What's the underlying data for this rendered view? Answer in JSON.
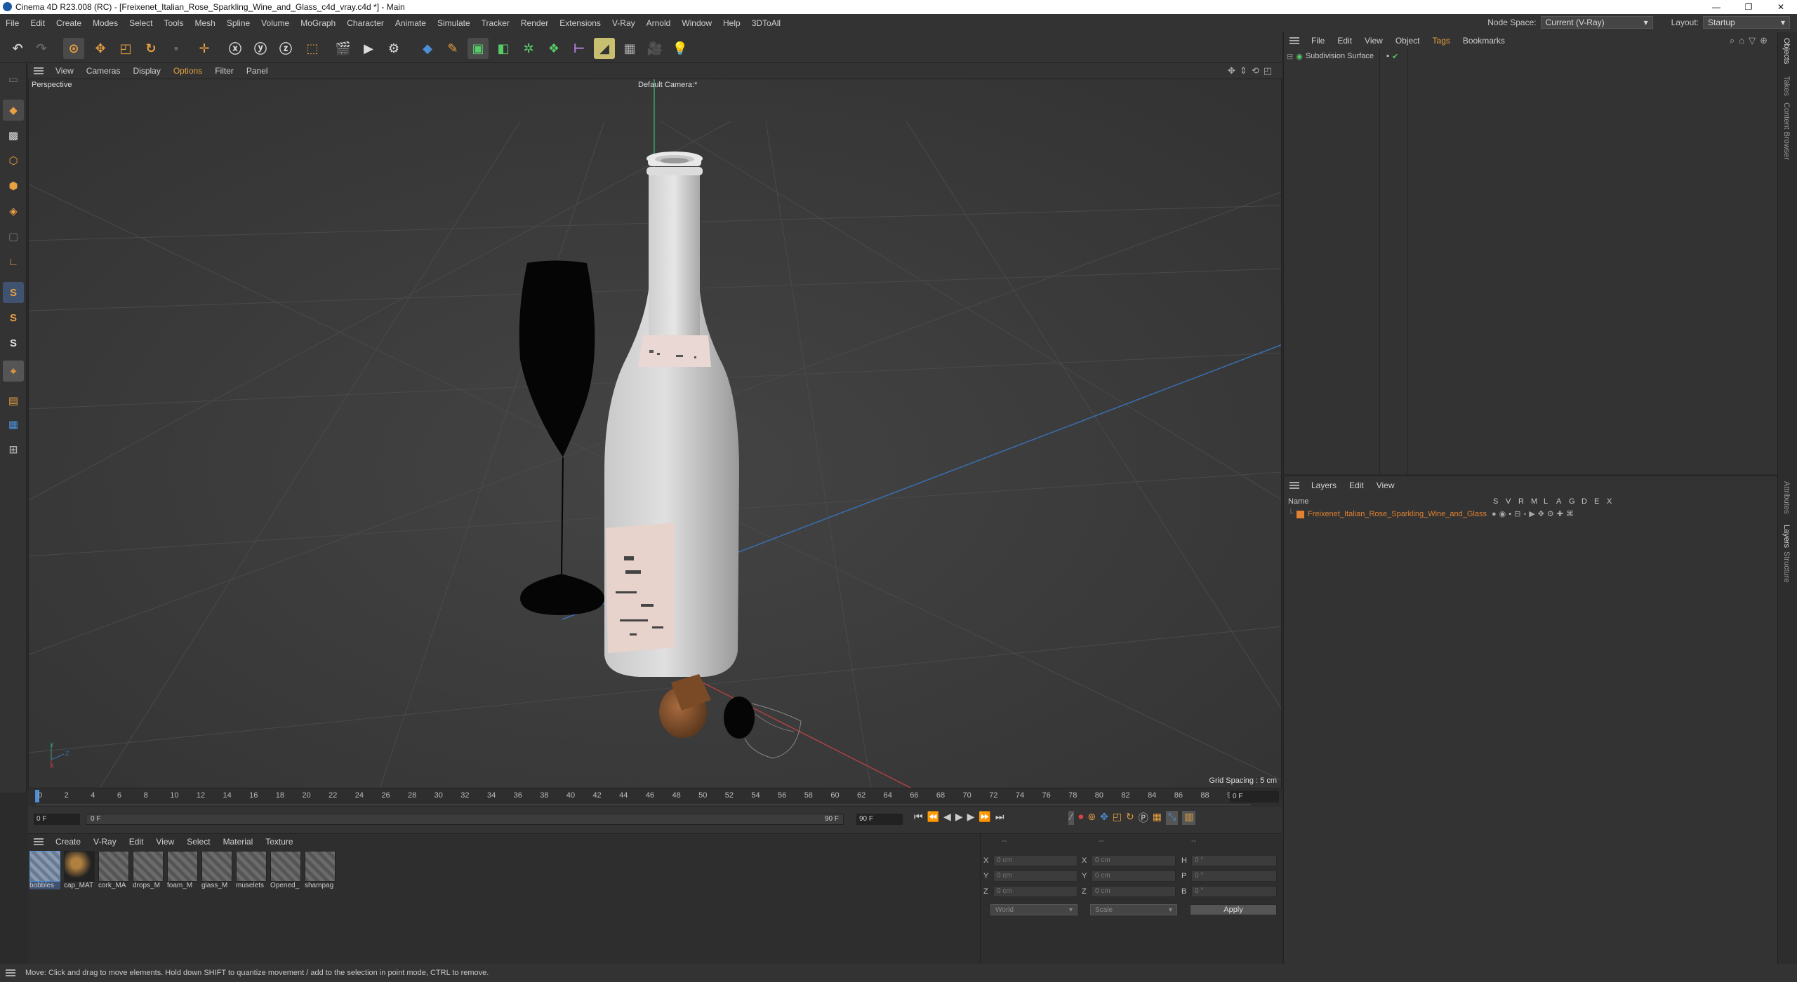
{
  "window": {
    "title": "Cinema 4D R23.008 (RC) - [Freixenet_Italian_Rose_Sparkling_Wine_and_Glass_c4d_vray.c4d *] - Main",
    "controls": [
      "—",
      "❐",
      "✕"
    ]
  },
  "menubar": {
    "items": [
      "File",
      "Edit",
      "Create",
      "Modes",
      "Select",
      "Tools",
      "Mesh",
      "Spline",
      "Volume",
      "MoGraph",
      "Character",
      "Animate",
      "Simulate",
      "Tracker",
      "Render",
      "Extensions",
      "V-Ray",
      "Arnold",
      "Window",
      "Help",
      "3DToAll"
    ],
    "node_space_label": "Node Space:",
    "node_space_value": "Current (V-Ray)",
    "layout_label": "Layout:",
    "layout_value": "Startup"
  },
  "viewport": {
    "menu": [
      "View",
      "Cameras",
      "Display",
      "Options",
      "Filter",
      "Panel"
    ],
    "view_name": "Perspective",
    "camera": "Default Camera",
    "camera_marker": ":*",
    "grid_spacing": "Grid Spacing : 5 cm",
    "axis_y": "Y",
    "axis_z": "Z",
    "axis_x": "X"
  },
  "timeline": {
    "ticks": [
      "0",
      "2",
      "4",
      "6",
      "8",
      "10",
      "12",
      "14",
      "16",
      "18",
      "20",
      "22",
      "24",
      "26",
      "28",
      "30",
      "32",
      "34",
      "36",
      "38",
      "40",
      "42",
      "44",
      "46",
      "48",
      "50",
      "52",
      "54",
      "56",
      "58",
      "60",
      "62",
      "64",
      "66",
      "68",
      "70",
      "72",
      "74",
      "76",
      "78",
      "80",
      "82",
      "84",
      "86",
      "88",
      "90"
    ],
    "current_frame": "0 F"
  },
  "frameinfo": {
    "start": "0 F",
    "current": "0 F",
    "end_mark": "90 F",
    "end": "90 F"
  },
  "materials": {
    "menu": [
      "Create",
      "V-Ray",
      "Edit",
      "View",
      "Select",
      "Material",
      "Texture"
    ],
    "items": [
      "bobbles",
      "cap_MAT",
      "cork_MA",
      "drops_M",
      "foam_M",
      "glass_M",
      "muselets",
      "Opened_",
      "shampag"
    ]
  },
  "coords": {
    "header": [
      "--",
      "--",
      "--"
    ],
    "rows": [
      {
        "a": "X",
        "av": "0 cm",
        "b": "X",
        "bv": "0 cm",
        "c": "H",
        "cv": "0 °"
      },
      {
        "a": "Y",
        "av": "0 cm",
        "b": "Y",
        "bv": "0 cm",
        "c": "P",
        "cv": "0 °"
      },
      {
        "a": "Z",
        "av": "0 cm",
        "b": "Z",
        "bv": "0 cm",
        "c": "B",
        "cv": "0 °"
      }
    ],
    "world": "World",
    "scale": "Scale",
    "apply": "Apply"
  },
  "objects": {
    "menu": [
      "File",
      "Edit",
      "View",
      "Object",
      "Tags",
      "Bookmarks"
    ],
    "items": [
      "Subdivision Surface"
    ]
  },
  "layers": {
    "menu": [
      "Layers",
      "Edit",
      "View"
    ],
    "name_header": "Name",
    "flag_headers": [
      "S",
      "V",
      "R",
      "M",
      "L",
      "A",
      "G",
      "D",
      "E",
      "X"
    ],
    "items": [
      "Freixenet_Italian_Rose_Sparkling_Wine_and_Glass"
    ]
  },
  "right_tabs": [
    "Objects",
    "Takes",
    "Content Browser",
    "Attributes",
    "Layers",
    "Structure"
  ],
  "status": "Move: Click and drag to move elements. Hold down SHIFT to quantize movement / add to the selection in point mode, CTRL to remove.",
  "colors": {
    "accent": "#4d8fd6",
    "layer_orange": "#e08030",
    "tags_orange": "#e6a040"
  }
}
